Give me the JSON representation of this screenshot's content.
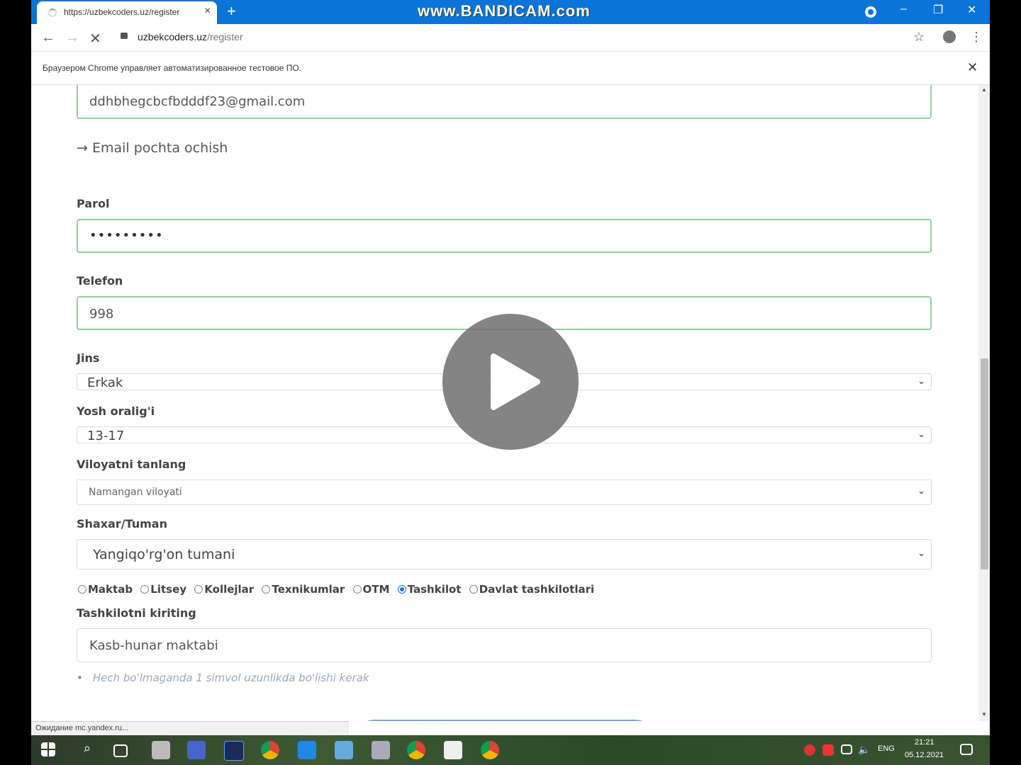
{
  "browser": {
    "tab_title": "https://uzbekcoders.uz/register",
    "tab_close": "×",
    "new_tab": "+",
    "watermark": "www.BANDICAM.com",
    "url_host": "uzbekcoders.uz",
    "url_path": "/register",
    "automation_notice": "Браузером Chrome управляет автоматизированное тестовое ПО.",
    "status_text": "Ожидание mc.yandex.ru..."
  },
  "form": {
    "email_value": "ddhbhegcbcfbdddf23@gmail.com",
    "email_link": "→ Email pochta ochish",
    "password_label": "Parol",
    "password_value": "•••••••••",
    "phone_label": "Telefon",
    "phone_value": "998",
    "gender_label": "Jins",
    "gender_value": "Erkak",
    "age_label": "Yosh oralig'i",
    "age_value": "13-17",
    "region_label": "Viloyatni tanlang",
    "region_value": "Namangan viloyati",
    "district_label": "Shaxar/Tuman",
    "district_value": "Yangiqo'rg'on tumani",
    "org_types": [
      {
        "label": "Maktab",
        "checked": false
      },
      {
        "label": "Litsey",
        "checked": false
      },
      {
        "label": "Kollejlar",
        "checked": false
      },
      {
        "label": "Texnikumlar",
        "checked": false
      },
      {
        "label": "OTM",
        "checked": false
      },
      {
        "label": "Tashkilot",
        "checked": true
      },
      {
        "label": "Davlat tashkilotlari",
        "checked": false
      }
    ],
    "org_label": "Tashkilotni kiriting",
    "org_value": "Kasb-hunar maktabi",
    "hint": "Hech bo'lmaganda 1 simvol uzunlikda bo'lishi kerak"
  },
  "taskbar": {
    "language": "ENG",
    "time": "21:21",
    "date": "05.12.2021"
  },
  "colors": {
    "chrome_blue": "#0a74d9",
    "valid_border": "#8fd19e",
    "radio_checked": "#1a73e8"
  }
}
